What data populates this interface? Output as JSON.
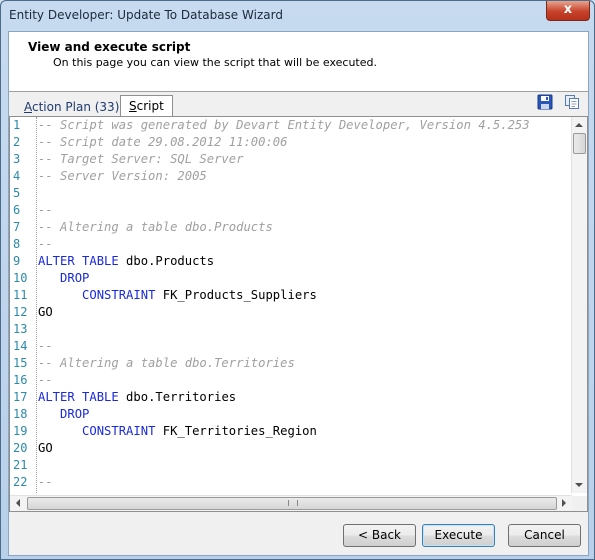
{
  "window": {
    "title": "Entity Developer: Update To Database Wizard",
    "close_label": "x"
  },
  "header": {
    "title": "View and execute script",
    "subtitle": "On this page you can view the script that will be executed."
  },
  "tabs": {
    "plan_prefix": "A",
    "plan_rest": "ction Plan (33)",
    "script_prefix": "S",
    "script_rest": "cript"
  },
  "toolbar_icons": [
    "save-icon",
    "copy-icon"
  ],
  "editor": {
    "lines": [
      {
        "n": "1",
        "segs": [
          {
            "t": "-- Script was generated by Devart Entity Developer, Version 4.5.253",
            "c": "cm"
          }
        ]
      },
      {
        "n": "2",
        "segs": [
          {
            "t": "-- Script date 29.08.2012 11:00:06",
            "c": "cm"
          }
        ]
      },
      {
        "n": "3",
        "segs": [
          {
            "t": "-- Target Server: SQL Server",
            "c": "cm"
          }
        ]
      },
      {
        "n": "4",
        "segs": [
          {
            "t": "-- Server Version: 2005",
            "c": "cm"
          }
        ]
      },
      {
        "n": "5",
        "segs": []
      },
      {
        "n": "6",
        "segs": [
          {
            "t": "--",
            "c": "cm"
          }
        ]
      },
      {
        "n": "7",
        "segs": [
          {
            "t": "-- Altering a table dbo.Products",
            "c": "cm"
          }
        ]
      },
      {
        "n": "8",
        "segs": [
          {
            "t": "--",
            "c": "cm"
          }
        ]
      },
      {
        "n": "9",
        "segs": [
          {
            "t": "ALTER TABLE",
            "c": "kw"
          },
          {
            "t": " dbo.Products",
            "c": ""
          }
        ]
      },
      {
        "n": "10",
        "segs": [
          {
            "t": "   ",
            "c": ""
          },
          {
            "t": "DROP",
            "c": "kw"
          }
        ]
      },
      {
        "n": "11",
        "segs": [
          {
            "t": "      ",
            "c": ""
          },
          {
            "t": "CONSTRAINT",
            "c": "kw"
          },
          {
            "t": " FK_Products_Suppliers",
            "c": ""
          }
        ]
      },
      {
        "n": "12",
        "segs": [
          {
            "t": "GO",
            "c": ""
          }
        ]
      },
      {
        "n": "13",
        "segs": []
      },
      {
        "n": "14",
        "segs": [
          {
            "t": "--",
            "c": "cm"
          }
        ]
      },
      {
        "n": "15",
        "segs": [
          {
            "t": "-- Altering a table dbo.Territories",
            "c": "cm"
          }
        ]
      },
      {
        "n": "16",
        "segs": [
          {
            "t": "--",
            "c": "cm"
          }
        ]
      },
      {
        "n": "17",
        "segs": [
          {
            "t": "ALTER TABLE",
            "c": "kw"
          },
          {
            "t": " dbo.Territories",
            "c": ""
          }
        ]
      },
      {
        "n": "18",
        "segs": [
          {
            "t": "   ",
            "c": ""
          },
          {
            "t": "DROP",
            "c": "kw"
          }
        ]
      },
      {
        "n": "19",
        "segs": [
          {
            "t": "      ",
            "c": ""
          },
          {
            "t": "CONSTRAINT",
            "c": "kw"
          },
          {
            "t": " FK_Territories_Region",
            "c": ""
          }
        ]
      },
      {
        "n": "20",
        "segs": [
          {
            "t": "GO",
            "c": ""
          }
        ]
      },
      {
        "n": "21",
        "segs": []
      },
      {
        "n": "22",
        "segs": [
          {
            "t": "--",
            "c": "cm"
          }
        ]
      }
    ]
  },
  "buttons": {
    "back": "< Back",
    "execute": "Execute",
    "cancel": "Cancel"
  },
  "colors": {
    "keyword": "#1a2ad8",
    "comment": "#a0a0a0",
    "line_number": "#2b8aaa"
  }
}
